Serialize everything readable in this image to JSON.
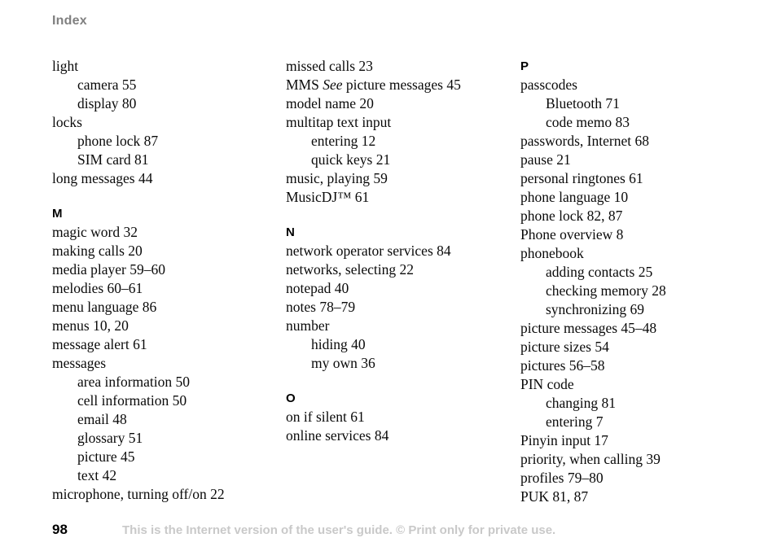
{
  "header": {
    "title": "Index"
  },
  "columns": [
    {
      "name": "index-column-1",
      "blocks": [
        {
          "type": "entry",
          "level": "main",
          "text": "light"
        },
        {
          "type": "entry",
          "level": "sub",
          "text": "camera 55"
        },
        {
          "type": "entry",
          "level": "sub",
          "text": "display 80"
        },
        {
          "type": "entry",
          "level": "main",
          "text": "locks"
        },
        {
          "type": "entry",
          "level": "sub",
          "text": "phone lock 87"
        },
        {
          "type": "entry",
          "level": "sub",
          "text": "SIM card 81"
        },
        {
          "type": "entry",
          "level": "main",
          "text": "long messages 44"
        },
        {
          "type": "letter",
          "text": "M"
        },
        {
          "type": "entry",
          "level": "main",
          "text": "magic word 32"
        },
        {
          "type": "entry",
          "level": "main",
          "text": "making calls 20"
        },
        {
          "type": "entry",
          "level": "main",
          "text": "media player 59–60"
        },
        {
          "type": "entry",
          "level": "main",
          "text": "melodies 60–61"
        },
        {
          "type": "entry",
          "level": "main",
          "text": "menu language 86"
        },
        {
          "type": "entry",
          "level": "main",
          "text": "menus 10, 20"
        },
        {
          "type": "entry",
          "level": "main",
          "text": "message alert 61"
        },
        {
          "type": "entry",
          "level": "main",
          "text": "messages"
        },
        {
          "type": "entry",
          "level": "sub",
          "text": "area information 50"
        },
        {
          "type": "entry",
          "level": "sub",
          "text": "cell information 50"
        },
        {
          "type": "entry",
          "level": "sub",
          "text": "email 48"
        },
        {
          "type": "entry",
          "level": "sub",
          "text": "glossary 51"
        },
        {
          "type": "entry",
          "level": "sub",
          "text": "picture 45"
        },
        {
          "type": "entry",
          "level": "sub",
          "text": "text 42"
        },
        {
          "type": "entry",
          "level": "main",
          "text": "microphone, turning off/on 22"
        }
      ]
    },
    {
      "name": "index-column-2",
      "blocks": [
        {
          "type": "entry",
          "level": "main",
          "text": "missed calls 23"
        },
        {
          "type": "entry",
          "level": "main",
          "html": "MMS <em>See</em> picture messages 45"
        },
        {
          "type": "entry",
          "level": "main",
          "text": "model name 20"
        },
        {
          "type": "entry",
          "level": "main",
          "text": "multitap text input"
        },
        {
          "type": "entry",
          "level": "sub",
          "text": "entering 12"
        },
        {
          "type": "entry",
          "level": "sub",
          "text": "quick keys 21"
        },
        {
          "type": "entry",
          "level": "main",
          "text": "music, playing 59"
        },
        {
          "type": "entry",
          "level": "main",
          "text": "MusicDJ™ 61"
        },
        {
          "type": "letter",
          "text": "N"
        },
        {
          "type": "entry",
          "level": "main",
          "text": "network operator services 84"
        },
        {
          "type": "entry",
          "level": "main",
          "text": "networks, selecting 22"
        },
        {
          "type": "entry",
          "level": "main",
          "text": "notepad 40"
        },
        {
          "type": "entry",
          "level": "main",
          "text": "notes 78–79"
        },
        {
          "type": "entry",
          "level": "main",
          "text": "number"
        },
        {
          "type": "entry",
          "level": "sub",
          "text": "hiding 40"
        },
        {
          "type": "entry",
          "level": "sub",
          "text": "my own 36"
        },
        {
          "type": "letter",
          "text": "O"
        },
        {
          "type": "entry",
          "level": "main",
          "text": "on if silent 61"
        },
        {
          "type": "entry",
          "level": "main",
          "text": "online services 84"
        }
      ]
    },
    {
      "name": "index-column-3",
      "blocks": [
        {
          "type": "letter",
          "text": "P"
        },
        {
          "type": "entry",
          "level": "main",
          "text": "passcodes"
        },
        {
          "type": "entry",
          "level": "sub",
          "text": "Bluetooth 71"
        },
        {
          "type": "entry",
          "level": "sub",
          "text": "code memo 83"
        },
        {
          "type": "entry",
          "level": "main",
          "text": "passwords, Internet 68"
        },
        {
          "type": "entry",
          "level": "main",
          "text": "pause 21"
        },
        {
          "type": "entry",
          "level": "main",
          "text": "personal ringtones 61"
        },
        {
          "type": "entry",
          "level": "main",
          "text": "phone language 10"
        },
        {
          "type": "entry",
          "level": "main",
          "text": "phone lock 82, 87"
        },
        {
          "type": "entry",
          "level": "main",
          "text": "Phone overview 8"
        },
        {
          "type": "entry",
          "level": "main",
          "text": "phonebook"
        },
        {
          "type": "entry",
          "level": "sub",
          "text": "adding contacts 25"
        },
        {
          "type": "entry",
          "level": "sub",
          "text": "checking memory 28"
        },
        {
          "type": "entry",
          "level": "sub",
          "text": "synchronizing 69"
        },
        {
          "type": "entry",
          "level": "main",
          "text": "picture messages 45–48"
        },
        {
          "type": "entry",
          "level": "main",
          "text": "picture sizes 54"
        },
        {
          "type": "entry",
          "level": "main",
          "text": "pictures 56–58"
        },
        {
          "type": "entry",
          "level": "main",
          "text": "PIN code"
        },
        {
          "type": "entry",
          "level": "sub",
          "text": "changing 81"
        },
        {
          "type": "entry",
          "level": "sub",
          "text": "entering 7"
        },
        {
          "type": "entry",
          "level": "main",
          "text": "Pinyin input 17"
        },
        {
          "type": "entry",
          "level": "main",
          "text": "priority, when calling 39"
        },
        {
          "type": "entry",
          "level": "main",
          "text": "profiles 79–80"
        },
        {
          "type": "entry",
          "level": "main",
          "text": "PUK 81, 87"
        }
      ]
    }
  ],
  "footer": {
    "page_number": "98",
    "note": "This is the Internet version of the user's guide. © Print only for private use."
  },
  "colors": {
    "title": "#808080",
    "body_text": "#0a0a0a",
    "footer_note": "#c9c9c9",
    "background": "#ffffff"
  }
}
